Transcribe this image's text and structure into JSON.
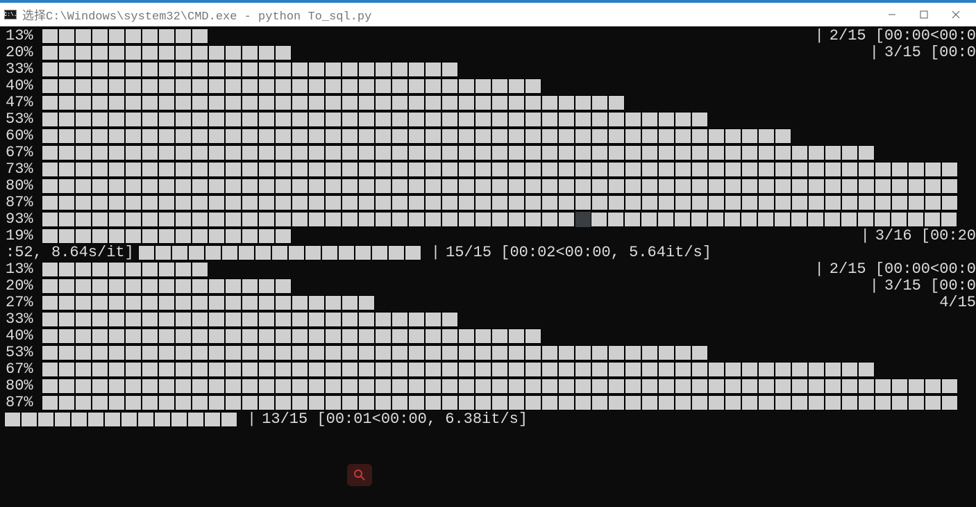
{
  "window": {
    "title": "选择C:\\Windows\\system32\\CMD.exe - python  To_sql.py",
    "icon_text": "C:\\."
  },
  "block1": {
    "rows": [
      {
        "pct": "13%",
        "cells": 10,
        "tail_sep": "|",
        "tail": "2/15 [00:00<00:0"
      },
      {
        "pct": "20%",
        "cells": 15,
        "tail_sep": "|",
        "tail": "3/15 [00:0"
      },
      {
        "pct": "33%",
        "cells": 25
      },
      {
        "pct": "40%",
        "cells": 30
      },
      {
        "pct": "47%",
        "cells": 35
      },
      {
        "pct": "53%",
        "cells": 40
      },
      {
        "pct": "60%",
        "cells": 45
      },
      {
        "pct": "67%",
        "cells": 50
      },
      {
        "pct": "73%",
        "cells": 55
      },
      {
        "pct": "80%",
        "cells": 55
      },
      {
        "pct": "87%",
        "cells": 55
      },
      {
        "pct": "93%",
        "cells": 55,
        "cursor_at": 32
      },
      {
        "pct": "19%",
        "cells": 15,
        "tail_sep": "|",
        "tail": "3/16 [00:20"
      }
    ]
  },
  "mid": {
    "prefix": ":52,  8.64s/it]",
    "cells": 17,
    "sep": "|",
    "stats": "15/15 [00:02<00:00,  5.64it/s]"
  },
  "block2": {
    "rows": [
      {
        "pct": "13%",
        "cells": 10,
        "tail_sep": "|",
        "tail": "2/15 [00:00<00:0"
      },
      {
        "pct": "20%",
        "cells": 15,
        "tail_sep": "|",
        "tail": "3/15 [00:0"
      },
      {
        "pct": "27%",
        "cells": 20,
        "tail_sep": "",
        "tail": "4/15"
      },
      {
        "pct": "33%",
        "cells": 25
      },
      {
        "pct": "40%",
        "cells": 30
      },
      {
        "pct": "53%",
        "cells": 40
      },
      {
        "pct": "67%",
        "cells": 50
      },
      {
        "pct": "80%",
        "cells": 55
      },
      {
        "pct": "87%",
        "cells": 55
      }
    ]
  },
  "bottom": {
    "cells": 14,
    "sep": "|",
    "stats": "13/15 [00:01<00:00,  6.38it/s]"
  }
}
